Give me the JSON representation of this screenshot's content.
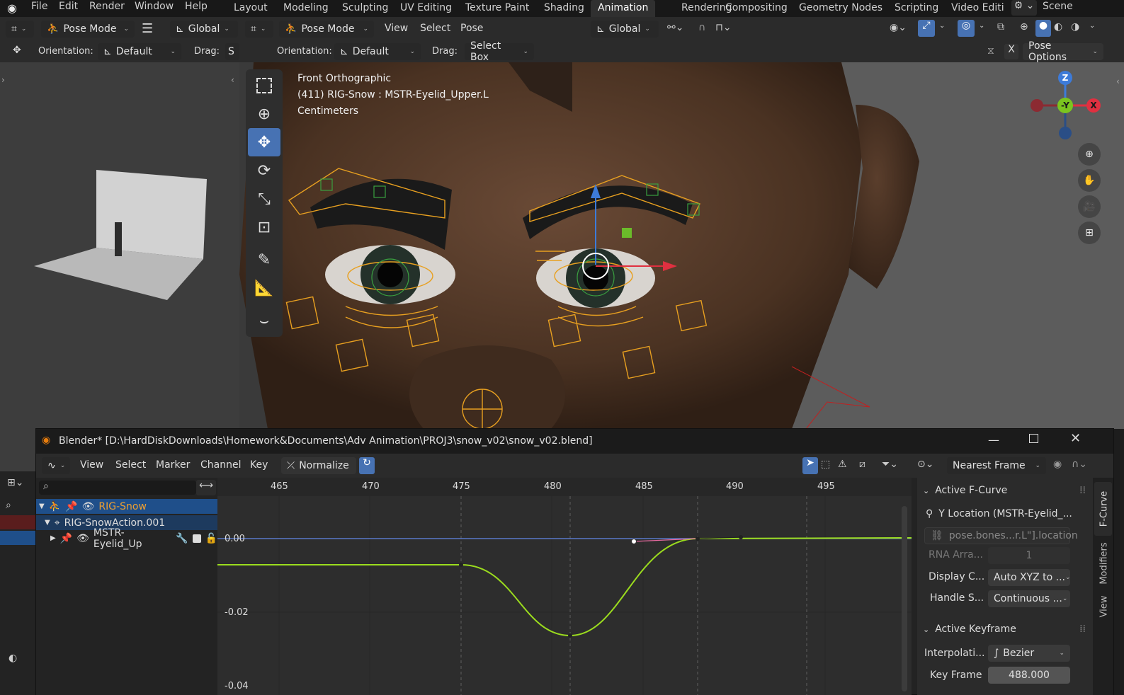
{
  "app": {
    "menu": [
      "File",
      "Edit",
      "Render",
      "Window",
      "Help"
    ],
    "workspaces": [
      "Layout",
      "Modeling",
      "Sculpting",
      "UV Editing",
      "Texture Paint",
      "Shading",
      "Animation",
      "Rendering",
      "Compositing",
      "Geometry Nodes",
      "Scripting",
      "Video Editi"
    ],
    "active_workspace": "Animation",
    "scene_label": "Scene"
  },
  "left_viewport": {
    "mode": "Pose Mode",
    "orientation_global": "Global",
    "orientation_label": "Orientation:",
    "orientation_value": "Default",
    "drag_label": "Drag:",
    "drag_value": "S"
  },
  "main_viewport": {
    "mode": "Pose Mode",
    "menus": [
      "View",
      "Select",
      "Pose"
    ],
    "transform_orientation": "Global",
    "orientation_label": "Orientation:",
    "orientation_value": "Default",
    "drag_label": "Drag:",
    "drag_value": "Select Box",
    "x_label": "X",
    "pose_options": "Pose Options",
    "overlay_line1": "Front Orthographic",
    "overlay_line2": "(411) RIG-Snow : MSTR-Eyelid_Upper.L",
    "overlay_line3": "Centimeters",
    "gizmo": {
      "z": "Z",
      "y": "-Y",
      "x": "X"
    }
  },
  "graph_window": {
    "title": "Blender* [D:\\HardDiskDownloads\\Homework&Documents\\Adv Animation\\PROJ3\\snow_v02\\snow_v02.blend]",
    "menus": [
      "View",
      "Select",
      "Marker",
      "Channel",
      "Key"
    ],
    "normalize": "Normalize",
    "snap_mode": "Nearest Frame",
    "channels": [
      {
        "label": "RIG-Snow",
        "level": 0
      },
      {
        "label": "RIG-SnowAction.001",
        "level": 1
      },
      {
        "label": "MSTR-Eyelid_Up",
        "level": 2
      }
    ],
    "frame_ticks": [
      "465",
      "470",
      "475",
      "480",
      "485",
      "490",
      "495"
    ],
    "value_ticks": [
      "0.00",
      "-0.02",
      "-0.04"
    ],
    "sidebar": {
      "active_fcurve_title": "Active F-Curve",
      "fcurve_name": "Y Location (MSTR-Eyelid_...",
      "data_path": "pose.bones...r.L\"].location",
      "rna_label": "RNA Arra...",
      "rna_value": "1",
      "display_label": "Display C...",
      "display_value": "Auto XYZ to ...",
      "handle_label": "Handle S...",
      "handle_value": "Continuous ...",
      "active_keyframe_title": "Active Keyframe",
      "interp_label": "Interpolati...",
      "interp_value": "Bezier",
      "keyframe_label": "Key Frame",
      "keyframe_value": "488.000"
    },
    "side_tabs": [
      "F-Curve",
      "Modifiers",
      "View"
    ]
  },
  "colors": {
    "accent": "#4772b3",
    "curve": "#9bdc1e",
    "bone": "#e8a020",
    "selected_channel": "#1f4f8a"
  }
}
